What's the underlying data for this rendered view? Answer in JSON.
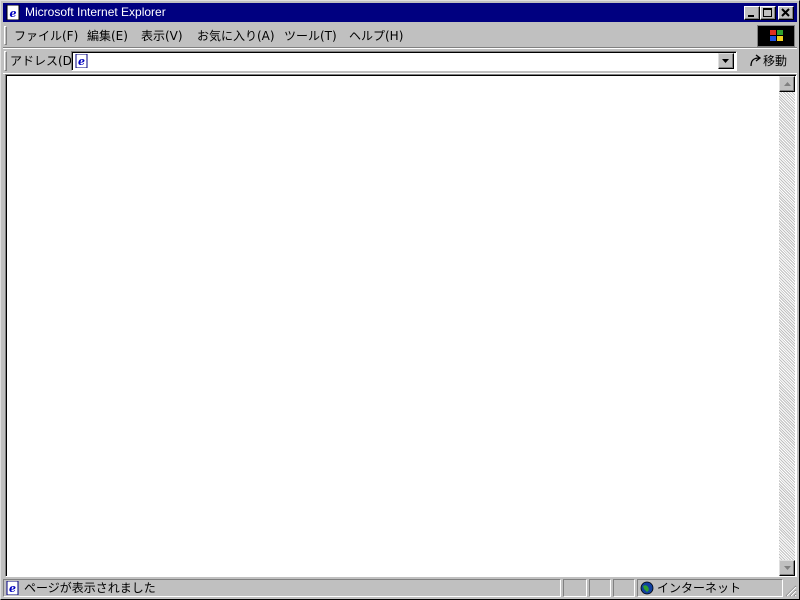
{
  "window": {
    "title": "Microsoft Internet Explorer",
    "icon": "ie-page-icon"
  },
  "title_controls": [
    {
      "name": "minimize",
      "icon": "minimize-icon"
    },
    {
      "name": "maximize",
      "icon": "maximize-icon"
    },
    {
      "name": "close",
      "icon": "close-icon"
    }
  ],
  "menu": {
    "items": [
      {
        "label": "ファイル(F)"
      },
      {
        "label": "編集(E)"
      },
      {
        "label": "表示(V)"
      },
      {
        "label": "お気に入り(A)"
      },
      {
        "label": "ツール(T)"
      },
      {
        "label": "ヘルプ(H)"
      }
    ],
    "throbber_icon": "windows-logo-icon"
  },
  "address_bar": {
    "label": "アドレス(D)",
    "value": "",
    "page_icon": "ie-page-icon",
    "dropdown_icon": "chevron-down-icon",
    "go_label": "移動",
    "go_icon": "go-arrow-icon"
  },
  "status_bar": {
    "text": "ページが表示されました",
    "status_icon": "ie-page-icon",
    "zone_label": "インターネット",
    "zone_icon": "globe-icon"
  },
  "colors": {
    "titlebar": "#000080",
    "chrome": "#c0c0c0",
    "content_background": "#ffffff"
  }
}
